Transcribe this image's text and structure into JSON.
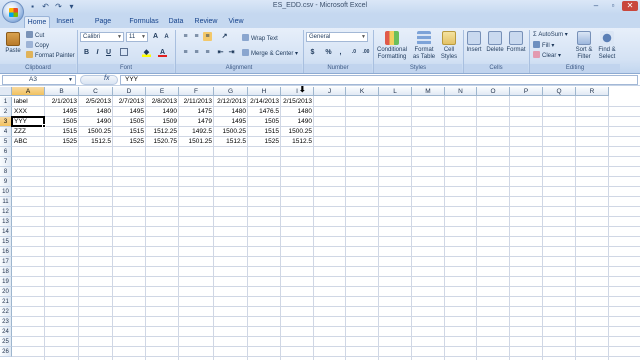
{
  "window": {
    "title": "ES_EDD.csv - Microsoft Excel"
  },
  "quick_access": {
    "icons": [
      "save-icon",
      "undo-icon",
      "redo-icon",
      "customize-icon"
    ]
  },
  "window_controls": {
    "minimize": "–",
    "maximize": "▫",
    "close": "✕"
  },
  "tabs": [
    "Home",
    "Insert",
    "Page Layout",
    "Formulas",
    "Data",
    "Review",
    "View"
  ],
  "ribbon": {
    "clipboard": {
      "paste": "Paste",
      "cut": "Cut",
      "copy": "Copy",
      "format_painter": "Format Painter",
      "label": "Clipboard"
    },
    "font": {
      "name": "Calibri",
      "size": "11",
      "grow": "A",
      "shrink": "A",
      "bold": "B",
      "italic": "I",
      "underline": "U",
      "color_letter": "A",
      "label": "Font"
    },
    "alignment": {
      "wrap": "Wrap Text",
      "merge": "Merge & Center",
      "label": "Alignment"
    },
    "number": {
      "format": "General",
      "currency": "$",
      "percent": "%",
      "comma": ",",
      "inc_dec": ".0",
      "dec_dec": ".00",
      "label": "Number"
    },
    "styles": {
      "conditional": "Conditional",
      "conditional2": "Formatting",
      "format_table": "Format",
      "format_table2": "as Table",
      "cell_styles": "Cell",
      "cell_styles2": "Styles",
      "label": "Styles"
    },
    "cells": {
      "insert": "Insert",
      "delete": "Delete",
      "format": "Format",
      "label": "Cells"
    },
    "editing": {
      "autosum": "AutoSum",
      "fill": "Fill",
      "clear": "Clear",
      "sort": "Sort &",
      "sort2": "Filter",
      "find": "Find &",
      "find2": "Select",
      "label": "Editing"
    }
  },
  "formula_bar": {
    "name_box": "A3",
    "fx": "fx",
    "content": "YYY"
  },
  "sheet": {
    "columns": [
      "A",
      "B",
      "C",
      "D",
      "E",
      "F",
      "G",
      "H",
      "I",
      "J",
      "K",
      "L",
      "M",
      "N",
      "O",
      "P",
      "Q",
      "R"
    ],
    "rows": [
      "1",
      "2",
      "3",
      "4",
      "5",
      "6",
      "7",
      "8",
      "9",
      "10",
      "11",
      "12",
      "13",
      "14",
      "15",
      "16",
      "17",
      "18",
      "19",
      "20",
      "21",
      "22",
      "23",
      "24",
      "25",
      "26"
    ],
    "data": [
      [
        "label",
        "2/1/2013",
        "2/5/2013",
        "2/7/2013",
        "2/8/2013",
        "2/11/2013",
        "2/12/2013",
        "2/14/2013",
        "2/15/2013"
      ],
      [
        "XXX",
        "1495",
        "1480",
        "1495",
        "1490",
        "1475",
        "1480",
        "1476.5",
        "1480"
      ],
      [
        "YYY",
        "1505",
        "1490",
        "1505",
        "1509",
        "1479",
        "1495",
        "1505",
        "1490"
      ],
      [
        "ZZZ",
        "1515",
        "1500.25",
        "1515",
        "1512.25",
        "1492.5",
        "1500.25",
        "1515",
        "1500.25"
      ],
      [
        "ABC",
        "1525",
        "1512.5",
        "1525",
        "1520.75",
        "1501.25",
        "1512.5",
        "1525",
        "1512.5"
      ]
    ],
    "selected_cell": "A3",
    "selected_column": "A",
    "selected_row": "3"
  },
  "colors": {
    "accent": "#1e395b",
    "selection": "#f1c15f",
    "grid": "#d0d7e5"
  }
}
